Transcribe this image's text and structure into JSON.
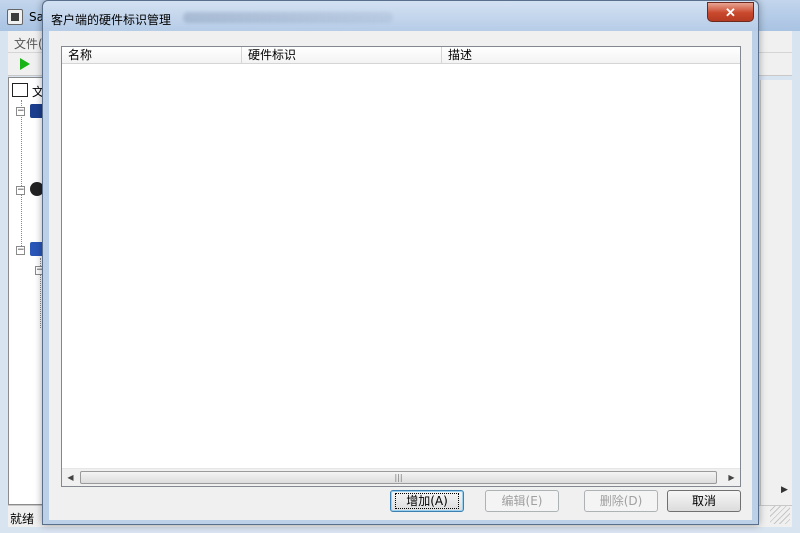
{
  "background_window": {
    "title": "Sa",
    "menu": "文件(",
    "tree_root_label": "文",
    "status": "就绪"
  },
  "dialog": {
    "title": "客户端的硬件标识管理",
    "close_symbol": "✕",
    "columns": [
      "名称",
      "硬件标识",
      "描述"
    ],
    "rows": [],
    "scrollbar": {
      "left_arrow": "◀",
      "right_arrow": "▶",
      "grip": "|||"
    },
    "buttons": {
      "add": "增加(A)",
      "edit": "编辑(E)",
      "delete": "删除(D)",
      "cancel": "取消"
    }
  }
}
